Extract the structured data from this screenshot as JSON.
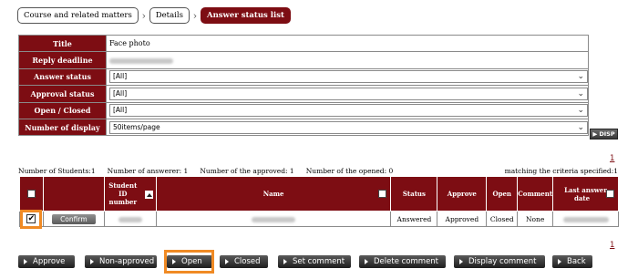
{
  "breadcrumb": [
    "Course and related matters",
    "Details",
    "Answer status list"
  ],
  "filters": {
    "title_label": "Title",
    "title_value": "Face photo",
    "deadline_label": "Reply deadline",
    "answer_status_label": "Answer status",
    "answer_status_value": "[All]",
    "approval_status_label": "Approval status",
    "approval_status_value": "[All]",
    "open_closed_label": "Open / Closed",
    "open_closed_value": "[All]",
    "display_label": "Number of display",
    "display_value": "50items/page",
    "disp_button": "DISP"
  },
  "page_number": "1",
  "counts": {
    "students": "Number of Students:1",
    "answerer": "Number of answerer: 1",
    "approved": "Number of the approved: 1",
    "opened": "Number of the opened: 0",
    "matching": "matching the criteria specified:1"
  },
  "table": {
    "headers": {
      "student_id": "Student ID number",
      "name": "Name",
      "status": "Status",
      "approve": "Approve",
      "open": "Open",
      "comment": "Comment",
      "last_answer": "Last answer date"
    },
    "row": {
      "checkmark": "✔",
      "confirm": "Confirm",
      "status": "Answered",
      "approve": "Approved",
      "open": "Closed",
      "comment": "None"
    }
  },
  "buttons": [
    "Approve",
    "Non-approved",
    "Open",
    "Closed",
    "Set comment",
    "Delete comment",
    "Display comment",
    "Back"
  ],
  "colors": {
    "accent": "#7d0d13",
    "highlight": "#f08a24"
  }
}
